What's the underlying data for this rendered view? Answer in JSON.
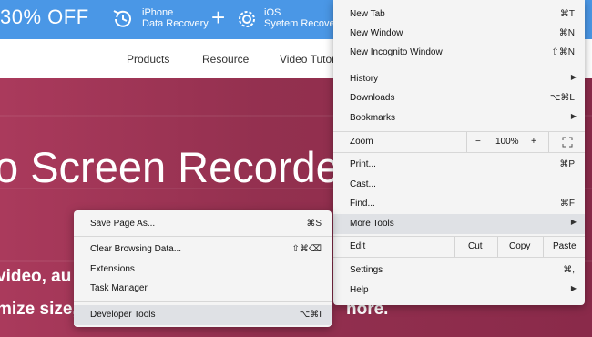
{
  "promo": {
    "offer": "30% OFF",
    "iphone_line1": "iPhone",
    "iphone_line2": "Data Recovery",
    "plus": "+",
    "ios_line1": "iOS",
    "ios_line2": "Syetem Recovery"
  },
  "nav": {
    "products": "Products",
    "resource": "Resource",
    "video_tutorials": "Video Tutor"
  },
  "hero": {
    "title": "o Screen Recorde",
    "line1": "video, au",
    "line2": "mize size,",
    "line2_tail": "nore."
  },
  "main_menu": {
    "new_tab": {
      "label": "New Tab",
      "shortcut": "⌘T"
    },
    "new_window": {
      "label": "New Window",
      "shortcut": "⌘N"
    },
    "new_incognito": {
      "label": "New Incognito Window",
      "shortcut": "⇧⌘N"
    },
    "history": {
      "label": "History"
    },
    "downloads": {
      "label": "Downloads",
      "shortcut": "⌥⌘L"
    },
    "bookmarks": {
      "label": "Bookmarks"
    },
    "zoom": {
      "label": "Zoom",
      "minus": "−",
      "value": "100%",
      "plus": "+"
    },
    "print": {
      "label": "Print...",
      "shortcut": "⌘P"
    },
    "cast": {
      "label": "Cast..."
    },
    "find": {
      "label": "Find...",
      "shortcut": "⌘F"
    },
    "more_tools": {
      "label": "More Tools"
    },
    "edit": {
      "label": "Edit",
      "cut": "Cut",
      "copy": "Copy",
      "paste": "Paste"
    },
    "settings": {
      "label": "Settings",
      "shortcut": "⌘,"
    },
    "help": {
      "label": "Help"
    }
  },
  "sub_menu": {
    "save_page": {
      "label": "Save Page As...",
      "shortcut": "⌘S"
    },
    "clear_browsing": {
      "label": "Clear Browsing Data...",
      "shortcut": "⇧⌘⌫"
    },
    "extensions": {
      "label": "Extensions"
    },
    "task_manager": {
      "label": "Task Manager"
    },
    "developer_tools": {
      "label": "Developer Tools",
      "shortcut": "⌥⌘I"
    }
  },
  "colors": {
    "promo_bar": "#4a97e6",
    "hero": "#93304f",
    "menu_bg": "#f4f4f4",
    "menu_highlight": "#dfe1e5"
  }
}
